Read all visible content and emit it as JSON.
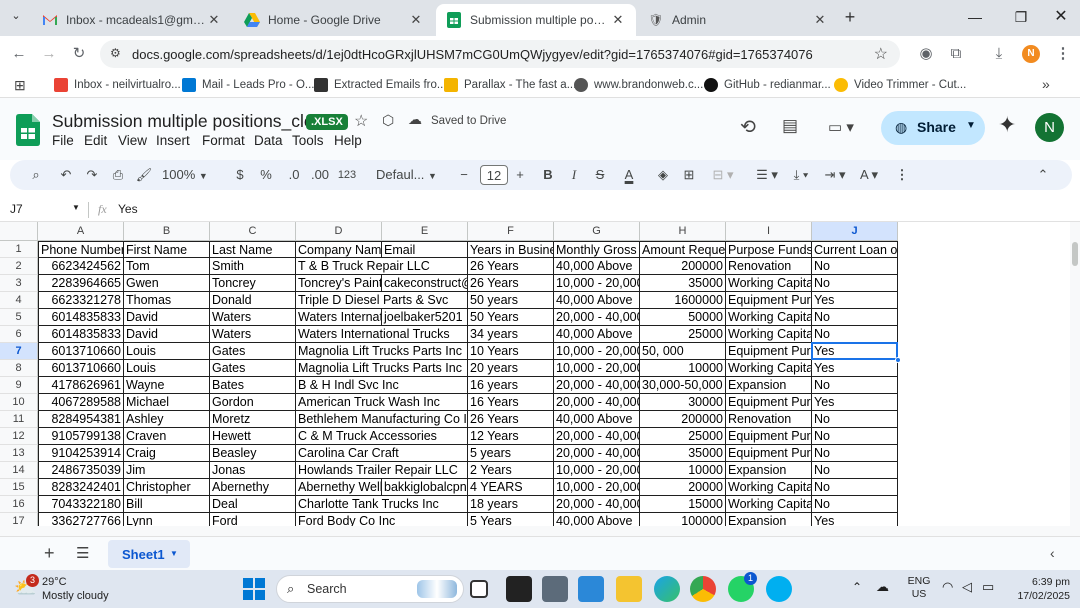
{
  "browser": {
    "tabs": [
      {
        "title": "Inbox - mcadeals1@gmail.com",
        "icon": "gmail-icon",
        "active": false
      },
      {
        "title": "Home - Google Drive",
        "icon": "drive-icon",
        "active": false
      },
      {
        "title": "Submission multiple positions_",
        "icon": "sheets-icon",
        "active": true
      },
      {
        "title": "Admin",
        "icon": "shield-admin-icon",
        "active": false
      }
    ],
    "url": "docs.google.com/spreadsheets/d/1ej0dtHcoGRxjlUHSM7mCG0UmQWjygyev/edit?gid=1765374076#gid=1765374076",
    "profile_initial": "N",
    "bookmarks": [
      {
        "label": "Inbox - neilvirtualro...",
        "color": "#ea4335"
      },
      {
        "label": "Mail - Leads Pro - O...",
        "color": "#0078d4"
      },
      {
        "label": "Extracted Emails fro...",
        "color": "#333333"
      },
      {
        "label": "Parallax - The fast a...",
        "color": "#f4b400"
      },
      {
        "label": "www.brandonweb.c...",
        "color": "#555555"
      },
      {
        "label": "GitHub - redianmar...",
        "color": "#111111"
      },
      {
        "label": "Video Trimmer - Cut...",
        "color": "#fbbc04"
      }
    ]
  },
  "doc": {
    "title": "Submission multiple positions_clean",
    "badge": ".XLSX",
    "save_status": "Saved to Drive",
    "menus": [
      "File",
      "Edit",
      "View",
      "Insert",
      "Format",
      "Data",
      "Tools",
      "Help"
    ],
    "share_label": "Share",
    "user_initial": "N"
  },
  "toolbar": {
    "zoom": "100%",
    "currency": "$",
    "percent": "%",
    "dec_decrease": ".0",
    "dec_increase": ".00",
    "number_format": "123",
    "font": "Defaul...",
    "font_size": "12",
    "bold": "B",
    "italic": "I",
    "strike": "S",
    "text_color": "A"
  },
  "formula_bar": {
    "cell_ref": "J7",
    "fx": "fx",
    "value": "Yes"
  },
  "grid": {
    "columns": [
      "A",
      "B",
      "C",
      "D",
      "E",
      "F",
      "G",
      "H",
      "I",
      "J"
    ],
    "selected_col": "J",
    "selected_row": 7,
    "header_row": [
      "Phone Number",
      "First Name",
      "Last Name",
      "Company Name",
      "Email",
      "Years in Business",
      "Monthly Gross",
      "Amount Requested",
      "Purpose Funds",
      "Current Loan or"
    ],
    "rows": [
      {
        "n": 2,
        "cells": [
          "6623424562",
          "Tom",
          "Smith",
          "T & B Truck Repair LLC",
          "",
          "26 Years",
          "40,000 Above",
          "200000",
          "Renovation",
          "No"
        ]
      },
      {
        "n": 3,
        "cells": [
          "2283964665",
          "Gwen",
          "Toncrey",
          "Toncrey's Paint",
          "cakeconstruct@",
          "26 Years",
          "10,000 - 20,000",
          "35000",
          "Working Capital",
          "No"
        ]
      },
      {
        "n": 4,
        "cells": [
          "6623321278",
          "Thomas",
          "Donald",
          "Triple D Diesel Parts & Svc",
          "",
          "50 years",
          "40,000 Above",
          "1600000",
          "Equipment Purchase",
          "Yes"
        ]
      },
      {
        "n": 5,
        "cells": [
          "6014835833",
          "David",
          "Waters",
          "Waters Internat",
          "joelbaker5201",
          "50 Years",
          "20,000 - 40,000",
          "50000",
          "Working Capital",
          "No"
        ]
      },
      {
        "n": 6,
        "cells": [
          "6014835833",
          "David",
          "Waters",
          "Waters International Trucks",
          "",
          "34 years",
          "40,000 Above",
          "25000",
          "Working Capital",
          "No"
        ]
      },
      {
        "n": 7,
        "cells": [
          "6013710660",
          "Louis",
          "Gates",
          "Magnolia Lift Trucks Parts Inc",
          "",
          "10 Years",
          "10,000 - 20,000",
          "50, 000",
          "Equipment Purchase",
          "Yes"
        ]
      },
      {
        "n": 8,
        "cells": [
          "6013710660",
          "Louis",
          "Gates",
          "Magnolia Lift Trucks Parts Inc",
          "",
          "20 years",
          "10,000 - 20,000",
          "10000",
          "Working Capital",
          "Yes"
        ]
      },
      {
        "n": 9,
        "cells": [
          "4178626961",
          "Wayne",
          "Bates",
          "B & H Indl Svc Inc",
          "",
          "16 years",
          "20,000 - 40,000",
          "30,000-50,000",
          "Expansion",
          "No"
        ]
      },
      {
        "n": 10,
        "cells": [
          "4067289588",
          "Michael",
          "Gordon",
          "American Truck Wash Inc",
          "",
          "16 Years",
          "20,000 - 40,000",
          "30000",
          "Equipment Purchase",
          "Yes"
        ]
      },
      {
        "n": 11,
        "cells": [
          "8284954381",
          "Ashley",
          "Moretz",
          "Bethlehem Manufacturing Co I",
          "",
          "26 Years",
          "40,000 Above",
          "200000",
          "Renovation",
          "No"
        ]
      },
      {
        "n": 12,
        "cells": [
          "9105799138",
          "Craven",
          "Hewett",
          "C & M Truck Accessories",
          "",
          "12 Years",
          "20,000 - 40,000",
          "25000",
          "Equipment Purchase",
          "No"
        ]
      },
      {
        "n": 13,
        "cells": [
          "9104253914",
          "Craig",
          "Beasley",
          "Carolina Car Craft",
          "",
          "5 years",
          "20,000 - 40,000",
          "35000",
          "Equipment Purchase",
          "No"
        ]
      },
      {
        "n": 14,
        "cells": [
          "2486735039",
          "Jim",
          "Jonas",
          "Howlands Trailer Repair LLC",
          "",
          "2 Years",
          "10,000 - 20,000",
          "10000",
          "Expansion",
          "No"
        ]
      },
      {
        "n": 15,
        "cells": [
          "8283242401",
          "Christopher",
          "Abernethy",
          "Abernethy Well",
          "bakkiglobalcpn",
          "4 YEARS",
          "10,000 - 20,000",
          "20000",
          "Working Capital",
          "No"
        ]
      },
      {
        "n": 16,
        "cells": [
          "7043322180",
          "Bill",
          "Deal",
          "Charlotte Tank Trucks Inc",
          "",
          "18 years",
          "20,000 - 40,000",
          "15000",
          "Working Capital",
          "No"
        ]
      },
      {
        "n": 17,
        "cells": [
          "3362727766",
          "Lynn",
          "Ford",
          "Ford Body Co Inc",
          "",
          "5 Years",
          "40,000 Above",
          "100000",
          "Expansion",
          "Yes"
        ]
      }
    ]
  },
  "sheets": {
    "active": "Sheet1"
  },
  "taskbar": {
    "weather_temp": "29°C",
    "weather_desc": "Mostly cloudy",
    "weather_badge": "3",
    "search_label": "Search",
    "lang": "ENG",
    "region": "US",
    "time": "6:39 pm",
    "date": "17/02/2025",
    "whatsapp_badge": "1"
  }
}
